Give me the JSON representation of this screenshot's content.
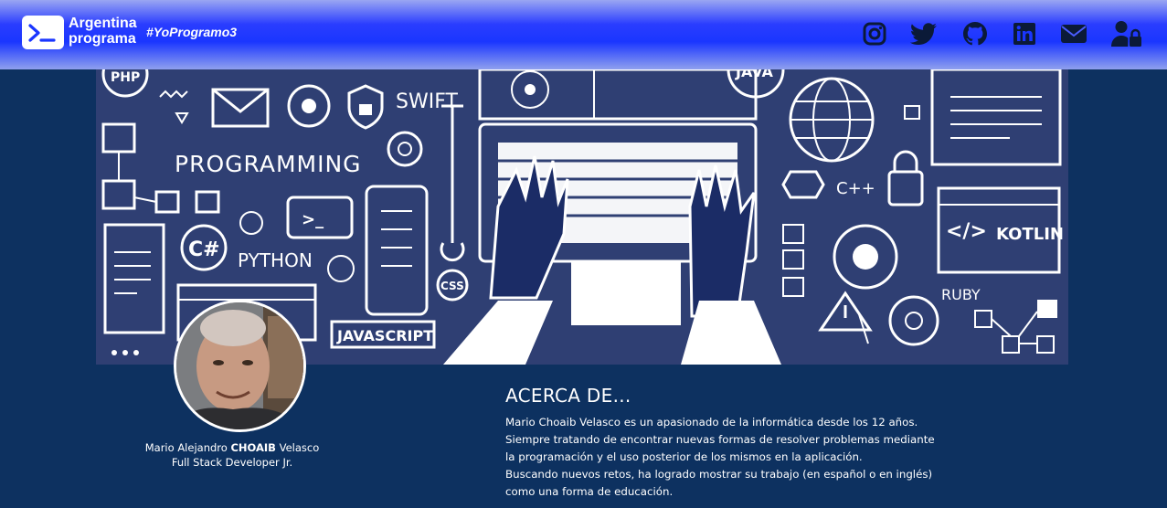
{
  "header": {
    "logo_line1": "Argentina",
    "logo_line2": "programa",
    "hashtag": "#YoProgramo3",
    "social": [
      {
        "name": "instagram-icon"
      },
      {
        "name": "twitter-icon"
      },
      {
        "name": "github-icon"
      },
      {
        "name": "linkedin-icon"
      },
      {
        "name": "mail-icon"
      },
      {
        "name": "user-lock-icon"
      }
    ]
  },
  "banner": {
    "labels": {
      "php": "PHP",
      "swift": "SWIFT",
      "java": "JAVA",
      "programming": "PROGRAMMING",
      "python": "PYTHON",
      "csharp": "C#",
      "javascript": "JAVASCRIPT",
      "css": "CSS",
      "cpp": "C++",
      "kotlin": "KOTLIN",
      "ruby": "RUBY",
      "terminal": ">_",
      "code": "</>"
    }
  },
  "profile": {
    "name_first": "Mario Alejandro ",
    "name_bold": "CHOAIB",
    "name_last": " Velasco",
    "role": "Full Stack Developer Jr."
  },
  "about": {
    "title": "ACERCA DE...",
    "lines": [
      "Mario Choaib Velasco es un apasionado de la informática desde los 12 años.",
      "Siempre tratando de encontrar nuevas formas de resolver problemas mediante",
      "la programación y el uso posterior de los mismos en la aplicación.",
      "Buscando nuevos retos, ha logrado mostrar su trabajo (en español o en inglés)",
      "como una forma de educación."
    ]
  },
  "colors": {
    "page_bg": "#0d3160",
    "header_accent": "#1a36ff",
    "banner_bg": "#2f3f73",
    "icon_dark": "#0b1a38"
  }
}
